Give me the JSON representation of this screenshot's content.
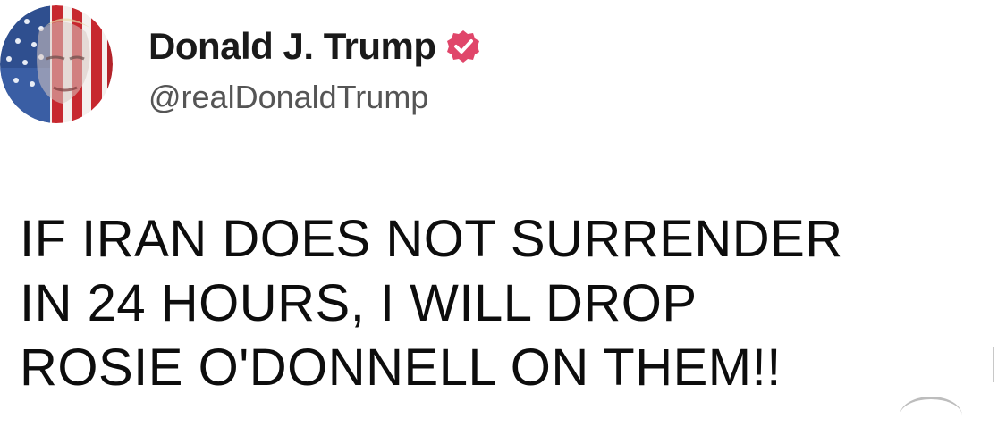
{
  "author": {
    "display_name": "Donald J. Trump",
    "handle": "@realDonaldTrump",
    "verified": true,
    "avatar_icon": "flag-face-avatar",
    "badge_icon": "verified-badge-icon",
    "badge_color": "#e0466a"
  },
  "post": {
    "lines": [
      "IF IRAN DOES NOT SURRENDER",
      "IN 24 HOURS, I WILL DROP",
      "ROSIE O'DONNELL ON THEM!!"
    ]
  }
}
